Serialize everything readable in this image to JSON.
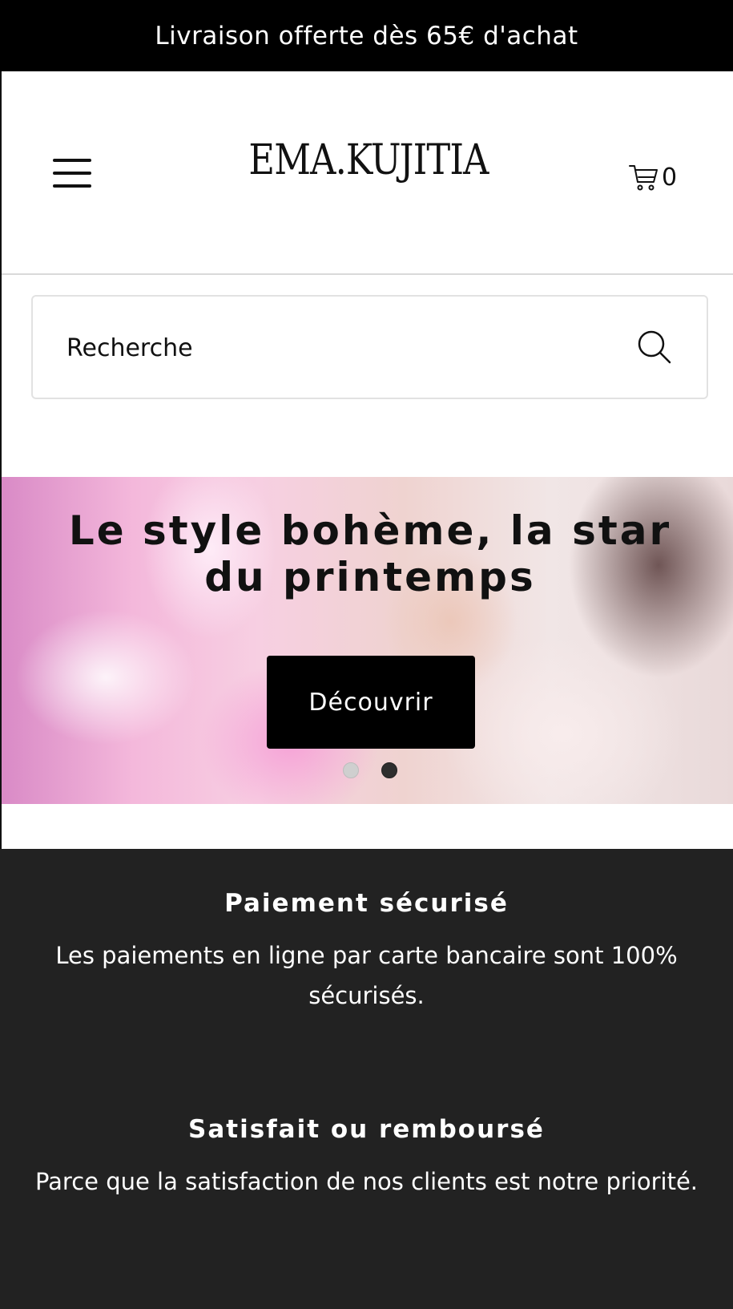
{
  "announcement": {
    "text": "Livraison offerte dès 65€ d'achat"
  },
  "header": {
    "logo": "EMA.KUJITIA",
    "cart_count": "0"
  },
  "search": {
    "placeholder": "Recherche"
  },
  "hero": {
    "title": "Le style bohème, la star du printemps",
    "button_label": "Découvrir",
    "slide_count": 2,
    "active_slide": 2
  },
  "features": [
    {
      "title": "Paiement sécurisé",
      "text": "Les paiements en ligne par carte bancaire sont 100% sécurisés."
    },
    {
      "title": "Satisfait ou remboursé",
      "text": "Parce que la satisfaction de nos clients est notre priorité."
    }
  ],
  "icons": {
    "menu": "hamburger-menu-icon",
    "cart": "shopping-cart-icon",
    "search": "search-icon"
  },
  "colors": {
    "announcement_bg": "#000000",
    "features_bg": "#222222",
    "button_bg": "#000000",
    "text_dark": "#111111"
  }
}
